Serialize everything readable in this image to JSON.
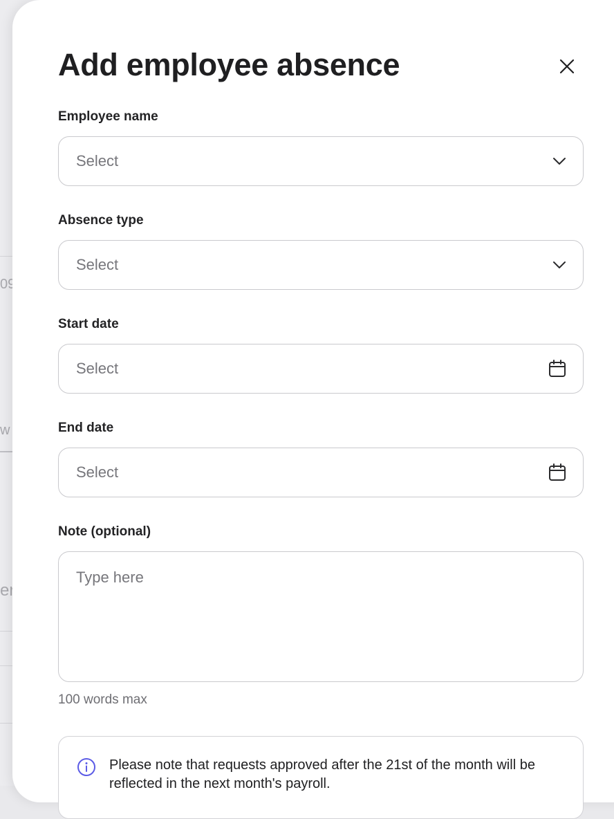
{
  "background": {
    "fragments": [
      "09",
      "w",
      "er"
    ]
  },
  "modal": {
    "title": "Add employee absence",
    "close_icon": "close-icon",
    "fields": {
      "employee_name": {
        "label": "Employee name",
        "placeholder": "Select",
        "icon": "chevron-down-icon"
      },
      "absence_type": {
        "label": "Absence type",
        "placeholder": "Select",
        "icon": "chevron-down-icon"
      },
      "start_date": {
        "label": "Start date",
        "placeholder": "Select",
        "icon": "calendar-icon"
      },
      "end_date": {
        "label": "End date",
        "placeholder": "Select",
        "icon": "calendar-icon"
      },
      "note": {
        "label": "Note (optional)",
        "placeholder": "Type here",
        "hint": "100 words max"
      }
    },
    "notice": {
      "icon": "info-icon",
      "text": "Please note that requests approved after the 21st of the month will be reflected in the next month's payroll."
    }
  },
  "colors": {
    "accent_info": "#5b5be6",
    "border": "#c9c9cd",
    "placeholder": "#76767b"
  }
}
